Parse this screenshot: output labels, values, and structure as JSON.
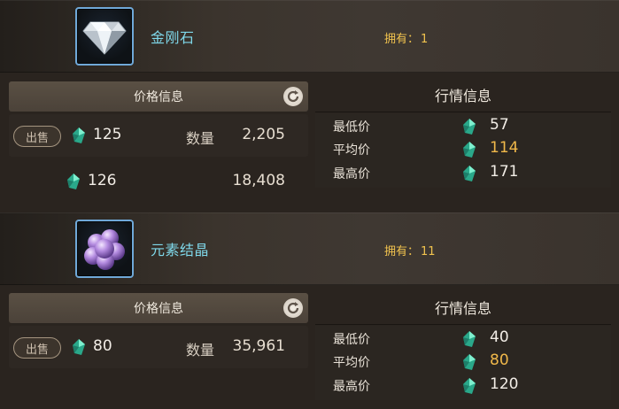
{
  "items": [
    {
      "name": "金刚石",
      "icon": "diamond-icon",
      "owned_label": "拥有：",
      "owned_count": "1",
      "price_panel": {
        "title": "价格信息",
        "sell_label": "出售",
        "rows": [
          {
            "price": "125",
            "qty_label": "数量",
            "qty": "2,205"
          },
          {
            "price": "126",
            "qty_label": "",
            "qty": "18,408"
          }
        ]
      },
      "market_panel": {
        "title": "行情信息",
        "rows": [
          {
            "label": "最低价",
            "value": "57"
          },
          {
            "label": "平均价",
            "value": "114"
          },
          {
            "label": "最高价",
            "value": "171"
          }
        ]
      }
    },
    {
      "name": "元素结晶",
      "icon": "purple-crystal-cluster-icon",
      "owned_label": "拥有：",
      "owned_count": "11",
      "price_panel": {
        "title": "价格信息",
        "sell_label": "出售",
        "rows": [
          {
            "price": "80",
            "qty_label": "数量",
            "qty": "35,961"
          }
        ]
      },
      "market_panel": {
        "title": "行情信息",
        "rows": [
          {
            "label": "最低价",
            "value": "40"
          },
          {
            "label": "平均价",
            "value": "80"
          },
          {
            "label": "最高价",
            "value": "120"
          }
        ]
      }
    }
  ],
  "colors": {
    "item_name": "#7fd8ea",
    "owned": "#f1c34e",
    "average_price": "#f0b84a",
    "currency_gem": "#35c9a7",
    "icon_border": "#6fa8d8"
  }
}
